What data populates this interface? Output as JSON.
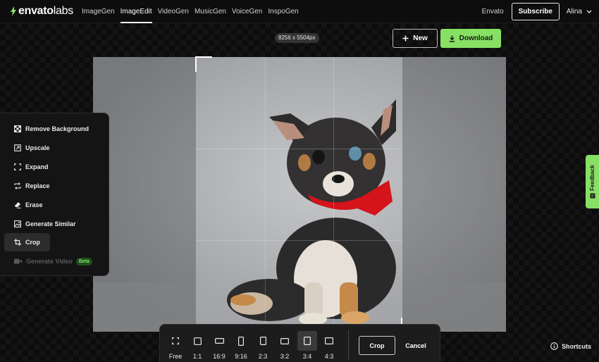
{
  "logo": {
    "main": "envato",
    "sub": "labs"
  },
  "nav": {
    "items": [
      {
        "label": "ImageGen",
        "active": false
      },
      {
        "label": "ImageEdit",
        "active": true
      },
      {
        "label": "VideoGen",
        "active": false
      },
      {
        "label": "MusicGen",
        "active": false
      },
      {
        "label": "VoiceGen",
        "active": false
      },
      {
        "label": "InspoGen",
        "active": false
      }
    ],
    "envato": "Envato",
    "subscribe": "Subscribe",
    "user": "Alina"
  },
  "canvas": {
    "size_label": "8256 x 5504px",
    "new_label": "New",
    "download_label": "Download"
  },
  "tools": [
    {
      "label": "Remove Background",
      "icon": "remove-background-icon",
      "state": "normal"
    },
    {
      "label": "Upscale",
      "icon": "upscale-icon",
      "state": "normal"
    },
    {
      "label": "Expand",
      "icon": "expand-icon",
      "state": "normal"
    },
    {
      "label": "Replace",
      "icon": "replace-icon",
      "state": "normal"
    },
    {
      "label": "Erase",
      "icon": "erase-icon",
      "state": "normal"
    },
    {
      "label": "Generate Similar",
      "icon": "image-icon",
      "state": "normal"
    },
    {
      "label": "Crop",
      "icon": "crop-icon",
      "state": "active"
    },
    {
      "label": "Generate Video",
      "icon": "video-icon",
      "state": "disabled",
      "badge": "Beta"
    }
  ],
  "crop_bar": {
    "ratios": [
      {
        "label": "Free",
        "active": false
      },
      {
        "label": "1:1",
        "active": false
      },
      {
        "label": "16:9",
        "active": false
      },
      {
        "label": "9:16",
        "active": false
      },
      {
        "label": "2:3",
        "active": false
      },
      {
        "label": "3:2",
        "active": false
      },
      {
        "label": "3:4",
        "active": true
      },
      {
        "label": "4:3",
        "active": false
      }
    ],
    "crop_label": "Crop",
    "cancel_label": "Cancel"
  },
  "feedback_label": "Feedback",
  "shortcuts_label": "Shortcuts",
  "colors": {
    "accent": "#87e064",
    "background": "#0d0d0d",
    "panel": "#141414"
  }
}
